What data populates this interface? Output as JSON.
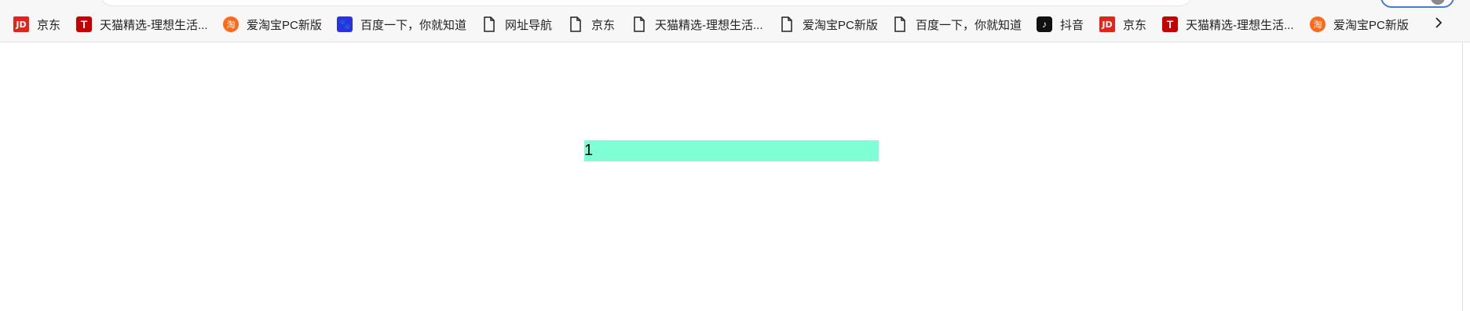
{
  "bookmarks": [
    {
      "label": "京东",
      "icon": "jd-icon"
    },
    {
      "label": "天猫精选-理想生活...",
      "icon": "tmall-icon"
    },
    {
      "label": "爱淘宝PC新版",
      "icon": "taobao-icon"
    },
    {
      "label": "百度一下，你就知道",
      "icon": "baidu-icon"
    },
    {
      "label": "网址导航",
      "icon": "page-icon"
    },
    {
      "label": "京东",
      "icon": "page-icon"
    },
    {
      "label": "天猫精选-理想生活...",
      "icon": "page-icon"
    },
    {
      "label": "爱淘宝PC新版",
      "icon": "page-icon"
    },
    {
      "label": "百度一下，你就知道",
      "icon": "page-icon"
    },
    {
      "label": "抖音",
      "icon": "douyin-icon"
    },
    {
      "label": "京东",
      "icon": "jd-icon"
    },
    {
      "label": "天猫精选-理想生活...",
      "icon": "tmall-icon"
    },
    {
      "label": "爱淘宝PC新版",
      "icon": "taobao-icon"
    }
  ],
  "content": {
    "bar_text": "1",
    "bar_color": "#7fffd4"
  }
}
